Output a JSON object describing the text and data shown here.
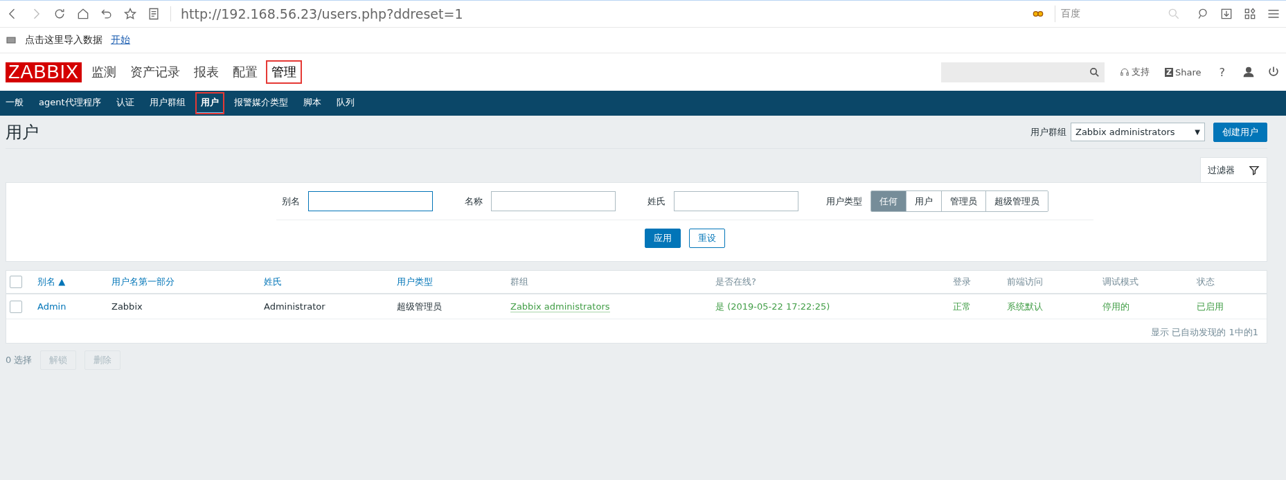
{
  "browser": {
    "url": "http://192.168.56.23/users.php?ddreset=1",
    "search_placeholder": "百度"
  },
  "bookmarks_bar": {
    "text": "点击这里导入数据",
    "link": "开始"
  },
  "header": {
    "logo": "ZABBIX",
    "menu": [
      {
        "label": "监测",
        "selected": false,
        "annotated": false
      },
      {
        "label": "资产记录",
        "selected": false,
        "annotated": false
      },
      {
        "label": "报表",
        "selected": false,
        "annotated": false
      },
      {
        "label": "配置",
        "selected": false,
        "annotated": false
      },
      {
        "label": "管理",
        "selected": true,
        "annotated": true
      }
    ],
    "links": [
      {
        "kind": "support",
        "label": "支持"
      },
      {
        "kind": "share",
        "badge": "Z",
        "label": "Share"
      }
    ],
    "help": "?"
  },
  "submenu": [
    {
      "label": "一般",
      "selected": false,
      "annotated": false
    },
    {
      "label": "agent代理程序",
      "selected": false,
      "annotated": false
    },
    {
      "label": "认证",
      "selected": false,
      "annotated": false
    },
    {
      "label": "用户群组",
      "selected": false,
      "annotated": false
    },
    {
      "label": "用户",
      "selected": true,
      "annotated": true
    },
    {
      "label": "报警媒介类型",
      "selected": false,
      "annotated": false
    },
    {
      "label": "脚本",
      "selected": false,
      "annotated": false
    },
    {
      "label": "队列",
      "selected": false,
      "annotated": false
    }
  ],
  "page": {
    "title": "用户",
    "group_label": "用户群组",
    "group_value": "Zabbix administrators",
    "group_caret": "▼",
    "create_button": "创建用户"
  },
  "filter": {
    "tab_label": "过滤器",
    "fields": [
      {
        "label": "别名",
        "focused": true
      },
      {
        "label": "名称",
        "focused": false
      },
      {
        "label": "姓氏",
        "focused": false
      }
    ],
    "user_type": {
      "label": "用户类型",
      "options": [
        {
          "label": "任何",
          "selected": true
        },
        {
          "label": "用户",
          "selected": false
        },
        {
          "label": "管理员",
          "selected": false
        },
        {
          "label": "超级管理员",
          "selected": false
        }
      ]
    },
    "buttons": [
      {
        "kind": "primary",
        "label": "应用"
      },
      {
        "kind": "secondary",
        "label": "重设"
      }
    ]
  },
  "table": {
    "all_checked": false,
    "columns": [
      {
        "label": "别名",
        "sortable": true,
        "sort_indicator": "▲"
      },
      {
        "label": "用户名第一部分",
        "sortable": true
      },
      {
        "label": "姓氏",
        "sortable": true
      },
      {
        "label": "用户类型",
        "sortable": true
      },
      {
        "label": "群组",
        "sortable": false
      },
      {
        "label": "是否在线?",
        "sortable": false
      },
      {
        "label": "登录",
        "sortable": false
      },
      {
        "label": "前端访问",
        "sortable": false
      },
      {
        "label": "调试模式",
        "sortable": false
      },
      {
        "label": "状态",
        "sortable": false
      }
    ],
    "rows": [
      {
        "checked": false,
        "cells": [
          {
            "kind": "link",
            "text": "Admin"
          },
          {
            "kind": "text",
            "text": "Zabbix"
          },
          {
            "kind": "text",
            "text": "Administrator"
          },
          {
            "kind": "text",
            "text": "超级管理员"
          },
          {
            "kind": "status-link",
            "text": "Zabbix administrators"
          },
          {
            "kind": "status",
            "text": "是 (2019-05-22 17:22:25)"
          },
          {
            "kind": "status",
            "text": "正常"
          },
          {
            "kind": "status",
            "text": "系统默认"
          },
          {
            "kind": "status",
            "text": "停用的"
          },
          {
            "kind": "status",
            "text": "已启用"
          }
        ]
      }
    ],
    "summary": "显示 已自动发现的 1中的1"
  },
  "footer": {
    "selected_count": "0 选择",
    "buttons": [
      {
        "label": "解锁",
        "disabled": true
      },
      {
        "label": "删除",
        "disabled": true
      }
    ]
  }
}
